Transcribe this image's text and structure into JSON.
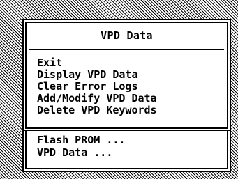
{
  "menu": {
    "title": "VPD Data",
    "items": [
      {
        "label": "Exit"
      },
      {
        "label": "Display VPD Data"
      },
      {
        "label": "Clear Error Logs"
      },
      {
        "label": "Add/Modify VPD Data"
      },
      {
        "label": "Delete VPD Keywords"
      }
    ]
  },
  "submenu": {
    "items": [
      {
        "label": "Flash PROM ..."
      },
      {
        "label": "VPD Data ..."
      }
    ]
  },
  "colors": {
    "foreground": "#000000",
    "background": "#ffffff"
  }
}
